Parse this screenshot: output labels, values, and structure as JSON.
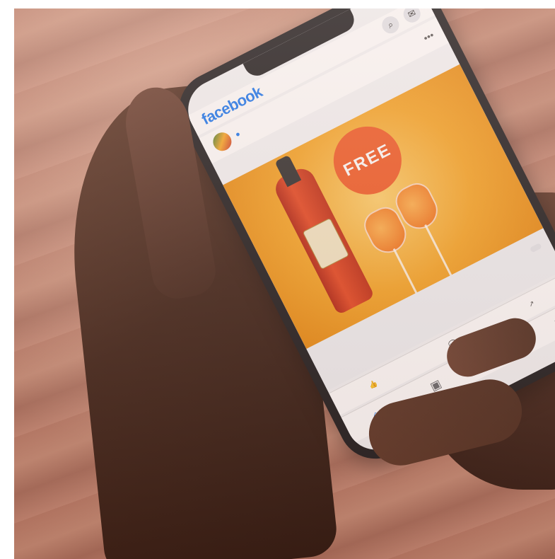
{
  "facebook": {
    "logo_text": "facebook",
    "status_time": "",
    "post": {
      "page_name": "",
      "meta": "",
      "text": ""
    },
    "ad": {
      "badge_title": "FREE",
      "badge_sub": ""
    },
    "cta": {
      "small": "",
      "title": "",
      "desc": "",
      "button": ""
    },
    "actions": {
      "like": "",
      "comment": "",
      "share": ""
    }
  },
  "colors": {
    "facebook_blue": "#1877f2",
    "ad_orange": "#f6a524",
    "badge": "#f15a24"
  }
}
